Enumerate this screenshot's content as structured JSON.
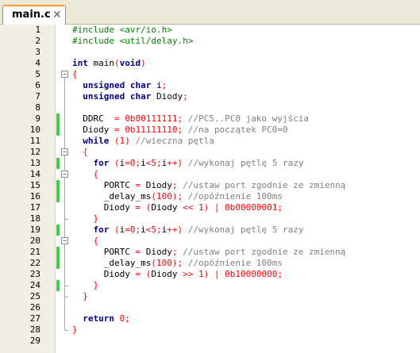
{
  "tab": {
    "label": "main.c",
    "close": "✕"
  },
  "colors": {
    "preprocessor": "#008000",
    "keyword": "#000080",
    "operator": "#ff0000",
    "comment": "#808080",
    "changed_marker": "#3cd23c"
  },
  "lines": [
    {
      "n": "1",
      "changed": false,
      "fold": "",
      "tokens": [
        [
          "pp",
          "#include <avr/io.h>"
        ]
      ]
    },
    {
      "n": "2",
      "changed": false,
      "fold": "",
      "tokens": [
        [
          "pp",
          "#include <util/delay.h>"
        ]
      ]
    },
    {
      "n": "3",
      "changed": false,
      "fold": "",
      "tokens": []
    },
    {
      "n": "4",
      "changed": false,
      "fold": "",
      "tokens": [
        [
          "kw",
          "int"
        ],
        [
          "id",
          " main"
        ],
        [
          "op",
          "("
        ],
        [
          "kw",
          "void"
        ],
        [
          "op",
          ")"
        ]
      ]
    },
    {
      "n": "5",
      "changed": false,
      "fold": "start",
      "tokens": [
        [
          "op",
          "{"
        ]
      ]
    },
    {
      "n": "6",
      "changed": false,
      "fold": "",
      "tokens": [
        [
          "id",
          "  "
        ],
        [
          "kw",
          "unsigned char"
        ],
        [
          "id",
          " i"
        ],
        [
          "op",
          ";"
        ]
      ]
    },
    {
      "n": "7",
      "changed": false,
      "fold": "",
      "tokens": [
        [
          "id",
          "  "
        ],
        [
          "kw",
          "unsigned char"
        ],
        [
          "id",
          " Diody"
        ],
        [
          "op",
          ";"
        ]
      ]
    },
    {
      "n": "8",
      "changed": false,
      "fold": "",
      "tokens": []
    },
    {
      "n": "9",
      "changed": true,
      "fold": "",
      "tokens": [
        [
          "id",
          "  DDRC  "
        ],
        [
          "op",
          "="
        ],
        [
          "id",
          " "
        ],
        [
          "num",
          "0b00111111"
        ],
        [
          "op",
          ";"
        ],
        [
          "id",
          " "
        ],
        [
          "cm",
          "//PC5..PC0 jako wyjścia"
        ]
      ]
    },
    {
      "n": "10",
      "changed": true,
      "fold": "",
      "tokens": [
        [
          "id",
          "  Diody "
        ],
        [
          "op",
          "="
        ],
        [
          "id",
          " "
        ],
        [
          "num",
          "0b11111110"
        ],
        [
          "op",
          ";"
        ],
        [
          "id",
          " "
        ],
        [
          "cm",
          "//na początek PC0=0"
        ]
      ]
    },
    {
      "n": "11",
      "changed": false,
      "fold": "",
      "tokens": [
        [
          "id",
          "  "
        ],
        [
          "kw",
          "while"
        ],
        [
          "id",
          " "
        ],
        [
          "op",
          "("
        ],
        [
          "num",
          "1"
        ],
        [
          "op",
          ")"
        ],
        [
          "id",
          " "
        ],
        [
          "cm",
          "//wieczna pętla"
        ]
      ]
    },
    {
      "n": "12",
      "changed": false,
      "fold": "start",
      "tokens": [
        [
          "id",
          "  "
        ],
        [
          "op",
          "{"
        ]
      ]
    },
    {
      "n": "13",
      "changed": true,
      "fold": "",
      "tokens": [
        [
          "id",
          "    "
        ],
        [
          "kw",
          "for"
        ],
        [
          "id",
          " "
        ],
        [
          "op",
          "("
        ],
        [
          "id",
          "i"
        ],
        [
          "op",
          "="
        ],
        [
          "num",
          "0"
        ],
        [
          "op",
          ";"
        ],
        [
          "id",
          "i"
        ],
        [
          "op",
          "<"
        ],
        [
          "num",
          "5"
        ],
        [
          "op",
          ";"
        ],
        [
          "id",
          "i"
        ],
        [
          "op",
          "++)"
        ],
        [
          "id",
          " "
        ],
        [
          "cm",
          "//wykonaj pętlę 5 razy"
        ]
      ]
    },
    {
      "n": "14",
      "changed": false,
      "fold": "start",
      "tokens": [
        [
          "id",
          "    "
        ],
        [
          "op",
          "{"
        ]
      ]
    },
    {
      "n": "15",
      "changed": true,
      "fold": "",
      "tokens": [
        [
          "id",
          "      PORTC "
        ],
        [
          "op",
          "="
        ],
        [
          "id",
          " Diody"
        ],
        [
          "op",
          ";"
        ],
        [
          "id",
          " "
        ],
        [
          "cm",
          "//ustaw port zgodnie ze zmienną"
        ]
      ]
    },
    {
      "n": "16",
      "changed": true,
      "fold": "",
      "tokens": [
        [
          "id",
          "      _delay_ms"
        ],
        [
          "op",
          "("
        ],
        [
          "num",
          "100"
        ],
        [
          "op",
          ");"
        ],
        [
          "id",
          " "
        ],
        [
          "cm",
          "//opóźnienie 100ms"
        ]
      ]
    },
    {
      "n": "17",
      "changed": false,
      "fold": "",
      "tokens": [
        [
          "id",
          "      Diody "
        ],
        [
          "op",
          "="
        ],
        [
          "id",
          " "
        ],
        [
          "op",
          "("
        ],
        [
          "id",
          "Diody "
        ],
        [
          "op",
          "<<"
        ],
        [
          "id",
          " "
        ],
        [
          "num",
          "1"
        ],
        [
          "op",
          ")"
        ],
        [
          "id",
          " "
        ],
        [
          "op",
          "|"
        ],
        [
          "id",
          " "
        ],
        [
          "num",
          "0b00000001"
        ],
        [
          "op",
          ";"
        ]
      ]
    },
    {
      "n": "18",
      "changed": false,
      "fold": "end",
      "tokens": [
        [
          "id",
          "    "
        ],
        [
          "op",
          "}"
        ]
      ]
    },
    {
      "n": "19",
      "changed": true,
      "fold": "",
      "tokens": [
        [
          "id",
          "    "
        ],
        [
          "kw",
          "for"
        ],
        [
          "id",
          " "
        ],
        [
          "op",
          "("
        ],
        [
          "id",
          "i"
        ],
        [
          "op",
          "="
        ],
        [
          "num",
          "0"
        ],
        [
          "op",
          ";"
        ],
        [
          "id",
          "i"
        ],
        [
          "op",
          "<"
        ],
        [
          "num",
          "5"
        ],
        [
          "op",
          ";"
        ],
        [
          "id",
          "i"
        ],
        [
          "op",
          "++)"
        ],
        [
          "id",
          " "
        ],
        [
          "cm",
          "//wykonaj pętlę 5 razy"
        ]
      ]
    },
    {
      "n": "20",
      "changed": false,
      "fold": "start",
      "tokens": [
        [
          "id",
          "    "
        ],
        [
          "op",
          "{"
        ]
      ]
    },
    {
      "n": "21",
      "changed": true,
      "fold": "",
      "tokens": [
        [
          "id",
          "      PORTC "
        ],
        [
          "op",
          "="
        ],
        [
          "id",
          " Diody"
        ],
        [
          "op",
          ";"
        ],
        [
          "id",
          " "
        ],
        [
          "cm",
          "//ustaw port zgodnie ze zmienną"
        ]
      ]
    },
    {
      "n": "22",
      "changed": true,
      "fold": "",
      "tokens": [
        [
          "id",
          "      _delay_ms"
        ],
        [
          "op",
          "("
        ],
        [
          "num",
          "100"
        ],
        [
          "op",
          ");"
        ],
        [
          "id",
          " "
        ],
        [
          "cm",
          "//opóźnienie 100ms"
        ]
      ]
    },
    {
      "n": "23",
      "changed": false,
      "fold": "",
      "tokens": [
        [
          "id",
          "      Diody "
        ],
        [
          "op",
          "="
        ],
        [
          "id",
          " "
        ],
        [
          "op",
          "("
        ],
        [
          "id",
          "Diody "
        ],
        [
          "op",
          ">>"
        ],
        [
          "id",
          " "
        ],
        [
          "num",
          "1"
        ],
        [
          "op",
          ")"
        ],
        [
          "id",
          " "
        ],
        [
          "op",
          "|"
        ],
        [
          "id",
          " "
        ],
        [
          "num",
          "0b10000000"
        ],
        [
          "op",
          ";"
        ]
      ]
    },
    {
      "n": "24",
      "changed": true,
      "fold": "end",
      "tokens": [
        [
          "id",
          "    "
        ],
        [
          "op",
          "}"
        ]
      ]
    },
    {
      "n": "25",
      "changed": false,
      "fold": "end",
      "tokens": [
        [
          "id",
          "  "
        ],
        [
          "op",
          "}"
        ]
      ]
    },
    {
      "n": "26",
      "changed": false,
      "fold": "",
      "tokens": []
    },
    {
      "n": "27",
      "changed": false,
      "fold": "",
      "tokens": [
        [
          "id",
          "  "
        ],
        [
          "kw",
          "return"
        ],
        [
          "id",
          " "
        ],
        [
          "num",
          "0"
        ],
        [
          "op",
          ";"
        ]
      ]
    },
    {
      "n": "28",
      "changed": false,
      "fold": "end",
      "tokens": [
        [
          "op",
          "}"
        ]
      ]
    },
    {
      "n": "29",
      "changed": false,
      "fold": "",
      "tokens": []
    }
  ]
}
